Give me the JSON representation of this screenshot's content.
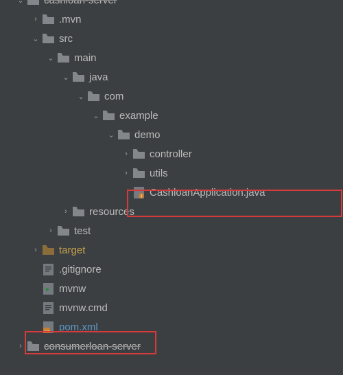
{
  "tree": {
    "root_strike": "cashloan-server",
    "mvn": ".mvn",
    "src": "src",
    "main": "main",
    "java": "java",
    "com": "com",
    "example": "example",
    "demo": "demo",
    "controller": "controller",
    "utils": "utils",
    "app_java": "CashloanApplication.java",
    "resources": "resources",
    "test": "test",
    "target": "target",
    "gitignore": ".gitignore",
    "mvnw": "mvnw",
    "mvnw_cmd": "mvnw.cmd",
    "pom": "pom.xml",
    "consumerloan": "consumerloan-server"
  }
}
